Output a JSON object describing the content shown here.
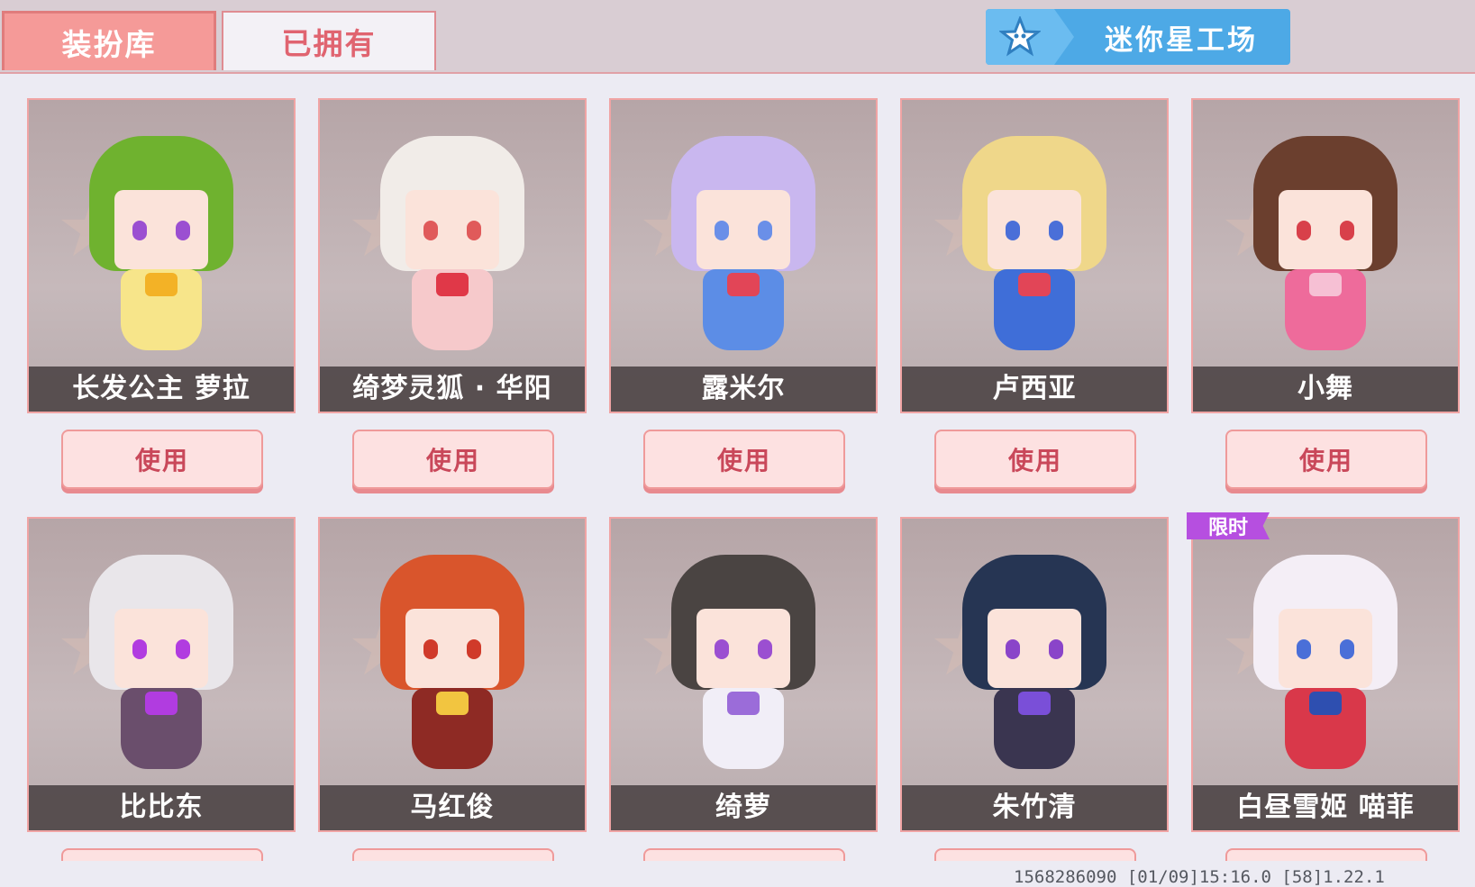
{
  "tabs": [
    {
      "label": "装扮库",
      "active": true
    },
    {
      "label": "已拥有",
      "active": false
    }
  ],
  "workshop": {
    "label": "迷你星工场",
    "icon": "star-icon"
  },
  "use_label": "使用",
  "cards": [
    {
      "name": "长发公主 萝拉",
      "hair": "#6fb22f",
      "body": "#f7e58a",
      "accent": "#f3b226",
      "eye": "#9b4fd1"
    },
    {
      "name": "绮梦灵狐 · 华阳",
      "hair": "#f1ece8",
      "body": "#f6c9cb",
      "accent": "#e03848",
      "eye": "#e05a5a"
    },
    {
      "name": "露米尔",
      "hair": "#c9b7ef",
      "body": "#5c8de6",
      "accent": "#e24557",
      "eye": "#6a8fe8"
    },
    {
      "name": "卢西亚",
      "hair": "#efd78a",
      "body": "#3f6ed8",
      "accent": "#e24557",
      "eye": "#4a6fd8"
    },
    {
      "name": "小舞",
      "hair": "#6b3f2e",
      "body": "#ee6b9b",
      "accent": "#f6c0d4",
      "eye": "#d8404a"
    },
    {
      "name": "比比东",
      "hair": "#e9e6ea",
      "body": "#6a4e6c",
      "accent": "#b13ce0",
      "eye": "#b13ce0"
    },
    {
      "name": "马红俊",
      "hair": "#d9552c",
      "body": "#8e2a24",
      "accent": "#f2c540",
      "eye": "#d03a2a"
    },
    {
      "name": "绮萝",
      "hair": "#4a4442",
      "body": "#f1eef7",
      "accent": "#9b6cd9",
      "eye": "#9b4fd1"
    },
    {
      "name": "朱竹清",
      "hair": "#263553",
      "body": "#3a3550",
      "accent": "#7a4fd8",
      "eye": "#8a44c9"
    },
    {
      "name": "白昼雪姬 喵菲",
      "hair": "#f4eef6",
      "body": "#d9384a",
      "accent": "#2e4fb0",
      "eye": "#4a6fd8"
    }
  ],
  "limited_badge": "限时",
  "footer": "1568286090  [01/09]15:16.0  [58]1.22.1"
}
